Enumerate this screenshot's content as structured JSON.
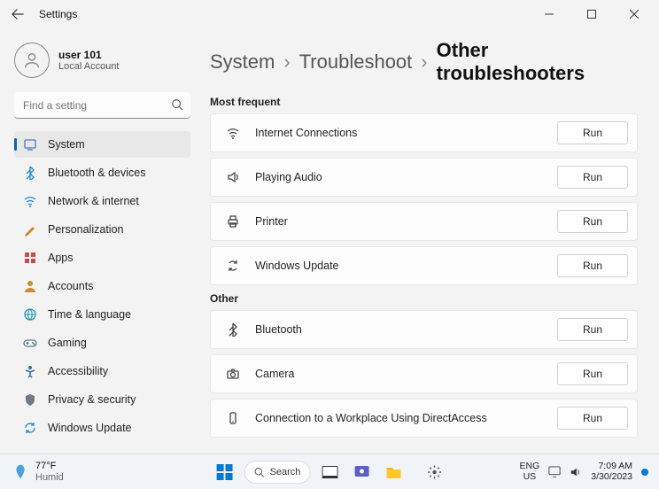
{
  "window": {
    "title": "Settings"
  },
  "account": {
    "name": "user 101",
    "sub": "Local Account"
  },
  "search": {
    "placeholder": "Find a setting"
  },
  "nav": {
    "items": [
      {
        "label": "System",
        "icon": "system",
        "color": "#4a7abf"
      },
      {
        "label": "Bluetooth & devices",
        "icon": "bluetooth",
        "color": "#1e88d2"
      },
      {
        "label": "Network & internet",
        "icon": "wifi",
        "color": "#1e88d2"
      },
      {
        "label": "Personalization",
        "icon": "pen",
        "color": "#c98a2b"
      },
      {
        "label": "Apps",
        "icon": "apps",
        "color": "#c0504d"
      },
      {
        "label": "Accounts",
        "icon": "person",
        "color": "#d08b2e"
      },
      {
        "label": "Time & language",
        "icon": "globe",
        "color": "#2196b5"
      },
      {
        "label": "Gaming",
        "icon": "game",
        "color": "#5b7d8c"
      },
      {
        "label": "Accessibility",
        "icon": "access",
        "color": "#2a6fb0"
      },
      {
        "label": "Privacy & security",
        "icon": "shield",
        "color": "#6e7a85"
      },
      {
        "label": "Windows Update",
        "icon": "update",
        "color": "#1e88d2"
      }
    ],
    "selected_index": 0
  },
  "breadcrumb": {
    "a": "System",
    "b": "Troubleshoot",
    "c": "Other troubleshooters"
  },
  "sections": [
    {
      "label": "Most frequent",
      "items": [
        {
          "label": "Internet Connections",
          "icon": "wifi",
          "btn": "Run"
        },
        {
          "label": "Playing Audio",
          "icon": "speaker",
          "btn": "Run"
        },
        {
          "label": "Printer",
          "icon": "printer",
          "btn": "Run"
        },
        {
          "label": "Windows Update",
          "icon": "sync",
          "btn": "Run"
        }
      ]
    },
    {
      "label": "Other",
      "items": [
        {
          "label": "Bluetooth",
          "icon": "bluetooth",
          "btn": "Run"
        },
        {
          "label": "Camera",
          "icon": "camera",
          "btn": "Run"
        },
        {
          "label": "Connection to a Workplace Using DirectAccess",
          "icon": "phone",
          "btn": "Run"
        }
      ]
    }
  ],
  "taskbar": {
    "weather": {
      "temp": "77°F",
      "cond": "Humid"
    },
    "search": "Search",
    "lang": "ENG",
    "region": "US",
    "time": "7:09 AM",
    "date": "3/30/2023"
  }
}
